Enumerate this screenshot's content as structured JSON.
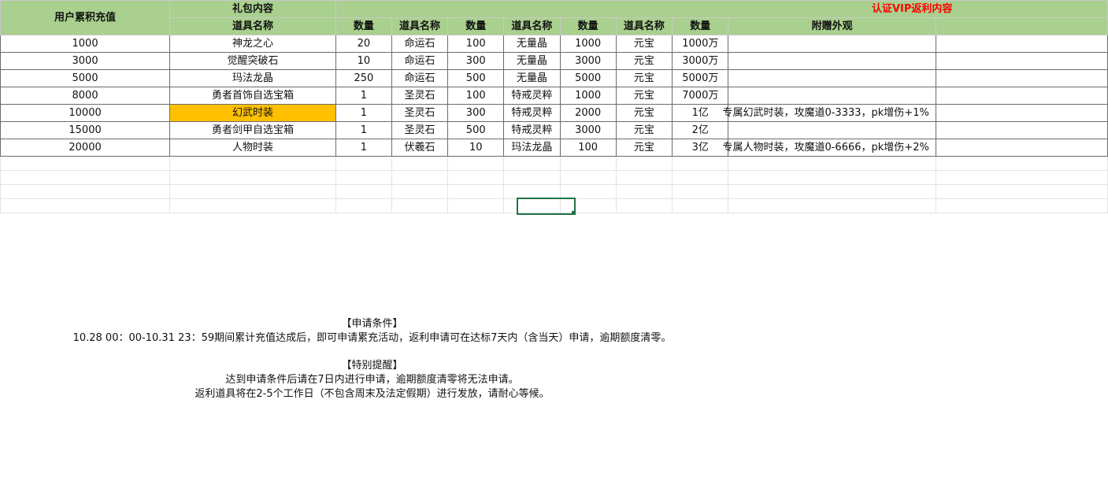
{
  "header": {
    "col_recharge": "用户累积充值",
    "col_gift": "礼包内容",
    "col_vip": "认证VIP返利内容",
    "sub_item_name": "道具名称",
    "sub_qty": "数量",
    "sub_item_name2": "道具名称",
    "sub_qty2": "数量",
    "sub_item_name3": "道具名称",
    "sub_qty3": "数量",
    "sub_item_name4": "道具名称",
    "sub_qty4": "数量",
    "sub_appearance": "附赠外观"
  },
  "rows": [
    {
      "recharge": "1000",
      "item1": "神龙之心",
      "qty1": "20",
      "item2": "命运石",
      "qty2": "100",
      "item3": "无量晶",
      "qty3": "1000",
      "item4": "元宝",
      "qty4": "1000万",
      "appearance": ""
    },
    {
      "recharge": "3000",
      "item1": "觉醒突破石",
      "qty1": "10",
      "item2": "命运石",
      "qty2": "300",
      "item3": "无量晶",
      "qty3": "3000",
      "item4": "元宝",
      "qty4": "3000万",
      "appearance": ""
    },
    {
      "recharge": "5000",
      "item1": "玛法龙晶",
      "qty1": "250",
      "item2": "命运石",
      "qty2": "500",
      "item3": "无量晶",
      "qty3": "5000",
      "item4": "元宝",
      "qty4": "5000万",
      "appearance": ""
    },
    {
      "recharge": "8000",
      "item1": "勇者首饰自选宝箱",
      "qty1": "1",
      "item2": "圣灵石",
      "qty2": "100",
      "item3": "特戒灵粹",
      "qty3": "1000",
      "item4": "元宝",
      "qty4": "7000万",
      "appearance": ""
    },
    {
      "recharge": "10000",
      "item1": "幻武时装",
      "qty1": "1",
      "item2": "圣灵石",
      "qty2": "300",
      "item3": "特戒灵粹",
      "qty3": "2000",
      "item4": "元宝",
      "qty4": "1亿",
      "appearance": "专属幻武时装，攻魔道0-3333，pk增伤+1%"
    },
    {
      "recharge": "15000",
      "item1": "勇者剑甲自选宝箱",
      "qty1": "1",
      "item2": "圣灵石",
      "qty2": "500",
      "item3": "特戒灵粹",
      "qty3": "3000",
      "item4": "元宝",
      "qty4": "2亿",
      "appearance": ""
    },
    {
      "recharge": "20000",
      "item1": "人物时装",
      "qty1": "1",
      "item2": "伏羲石",
      "qty2": "10",
      "item3": "玛法龙晶",
      "qty3": "100",
      "item4": "元宝",
      "qty4": "3亿",
      "appearance": "专属人物时装，攻魔道0-6666，pk增伤+2%"
    }
  ],
  "notes": {
    "cond_title": "【申请条件】",
    "cond_text": "10.28  00：00-10.31  23：59期间累计充值达成后，即可申请累充活动，返利申请可在达标7天内（含当天）申请，逾期额度清零。",
    "remind_title": "【特别提醒】",
    "remind_line1": "达到申请条件后请在7日内进行申请，逾期额度清零将无法申请。",
    "remind_line2": "返利道具将在2-5个工作日（不包含周末及法定假期）进行发放，请耐心等候。"
  },
  "colors": {
    "header_green": "#a9d08e",
    "highlight_orange": "#ffc000",
    "vip_red": "#ff0000",
    "selection_green": "#217346"
  }
}
